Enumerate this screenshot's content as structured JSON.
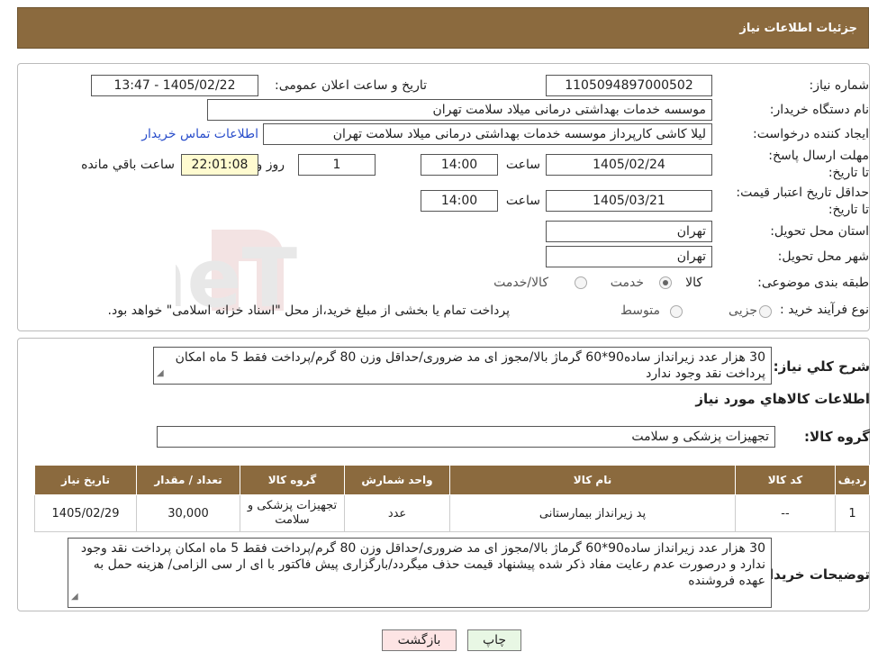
{
  "header": {
    "title": "جزئیات اطلاعات نیاز"
  },
  "form": {
    "need_number_label": "شماره نیاز:",
    "need_number": "1105094897000502",
    "announce_label": "تاریخ و ساعت اعلان عمومی:",
    "announce_value": "1405/02/22 - 13:47",
    "buyer_org_label": "نام دستگاه خریدار:",
    "buyer_org": "موسسه خدمات بهداشتی درمانی میلاد سلامت تهران",
    "creator_label": "ایجاد کننده درخواست:",
    "creator": "لیلا کاشی کارپرداز موسسه خدمات بهداشتی درمانی میلاد سلامت تهران",
    "contact_link": "اطلاعات تماس خریدار",
    "deadline_label": "مهلت ارسال پاسخ: تا تاریخ:",
    "deadline_date": "1405/02/24",
    "time_label": "ساعت",
    "deadline_time": "14:00",
    "days_value": "1",
    "days_label": "روز و",
    "remaining_time": "22:01:08",
    "remaining_label": "ساعت باقي مانده",
    "validity_label": "حداقل تاریخ اعتبار قیمت: تا تاریخ:",
    "validity_date": "1405/03/21",
    "validity_time": "14:00",
    "province_label": "استان محل تحویل:",
    "province": "تهران",
    "city_label": "شهر محل تحویل:",
    "city": "تهران",
    "category_label": "طبقه بندی موضوعی:",
    "category_options": [
      "کالا",
      "خدمت",
      "کالا/خدمت"
    ],
    "category_selected": "کالا",
    "process_label": "نوع فرآیند خرید :",
    "process_options": [
      "جزیی",
      "متوسط"
    ],
    "process_note": "پرداخت تمام یا بخشی از مبلغ خرید،از محل \"اسناد خزانه اسلامی\" خواهد بود."
  },
  "description": {
    "label": "شرح کلي نياز:",
    "text": "30 هزار عدد زیرانداز ساده90*60 گرماژ بالا/مجوز ای مد ضروری/حداقل وزن 80 گرم/پرداخت فقط 5 ماه امکان پرداخت نقد وجود ندارد",
    "items_title": "اطلاعات کالاهاي مورد نياز",
    "group_label": "گروه کالا:",
    "group_value": "تجهیزات پزشکی و سلامت"
  },
  "table": {
    "headers": [
      "رديف",
      "کد کالا",
      "نام کالا",
      "واحد شمارش",
      "گروه کالا",
      "تعداد / مقدار",
      "تاريخ نياز"
    ],
    "rows": [
      [
        "1",
        "--",
        "پد زیرانداز بیمارستانی",
        "عدد",
        "تجهیزات پزشکی و سلامت",
        "30,000",
        "1405/02/29"
      ]
    ]
  },
  "buyer_notes": {
    "label": "توضیحات خریدار:",
    "text": "30 هزار عدد زیرانداز ساده90*60 گرماژ بالا/مجوز ای مد ضروری/حداقل وزن 80 گرم/پرداخت فقط 5 ماه امکان پرداخت نقد وجود ندارد و درصورت عدم رعایت مفاد ذکر شده پیشنهاد قیمت حذف میگردد/بارگزاری پیش فاکتور با ای ار سی الزامی/ هزینه حمل به عهده فروشنده"
  },
  "buttons": {
    "print": "چاپ",
    "back": "بازگشت"
  },
  "watermark": {
    "text": "AriaTender.neT"
  },
  "colors": {
    "header_bg": "#8b6a3e",
    "link": "#2a4ecb",
    "highlight": "#fffbd0"
  }
}
